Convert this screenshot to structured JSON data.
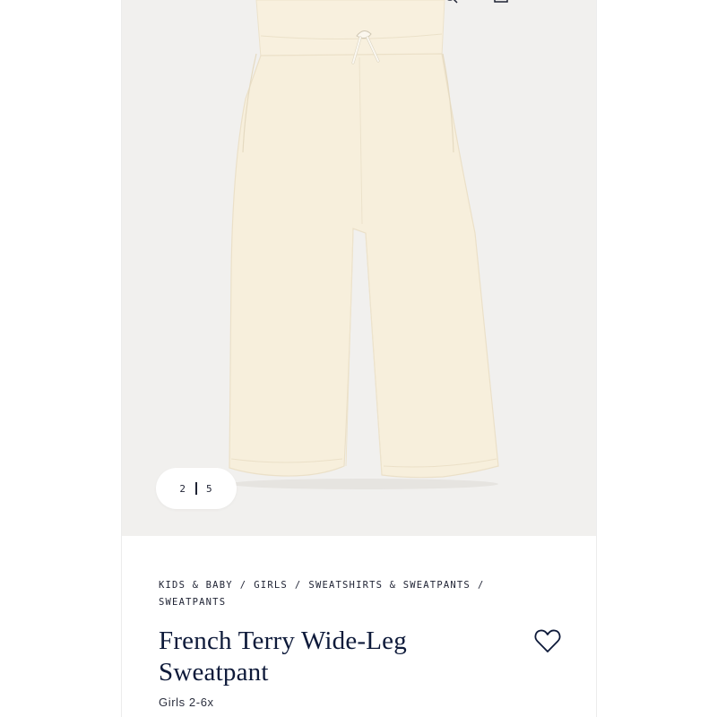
{
  "gallery": {
    "current_index": "2",
    "total_images": "5",
    "image_alt": "French Terry Wide-Leg Sweatpant in cream",
    "background_color": "#f1f0ee",
    "product_color": "#f7efdc"
  },
  "breadcrumb": {
    "items": [
      "KIDS & BABY",
      "GIRLS",
      "SWEATSHIRTS & SWEATPANTS",
      "SWEATPANTS"
    ],
    "separator": "/"
  },
  "product": {
    "title": "French Terry Wide-Leg Sweatpant",
    "subtitle": "Girls 2-6x"
  },
  "icons": {
    "wishlist": "heart-icon",
    "search": "search-icon",
    "bag": "bag-icon"
  },
  "colors": {
    "text_primary": "#0e1a3a",
    "text_secondary": "#2b2f3e"
  }
}
